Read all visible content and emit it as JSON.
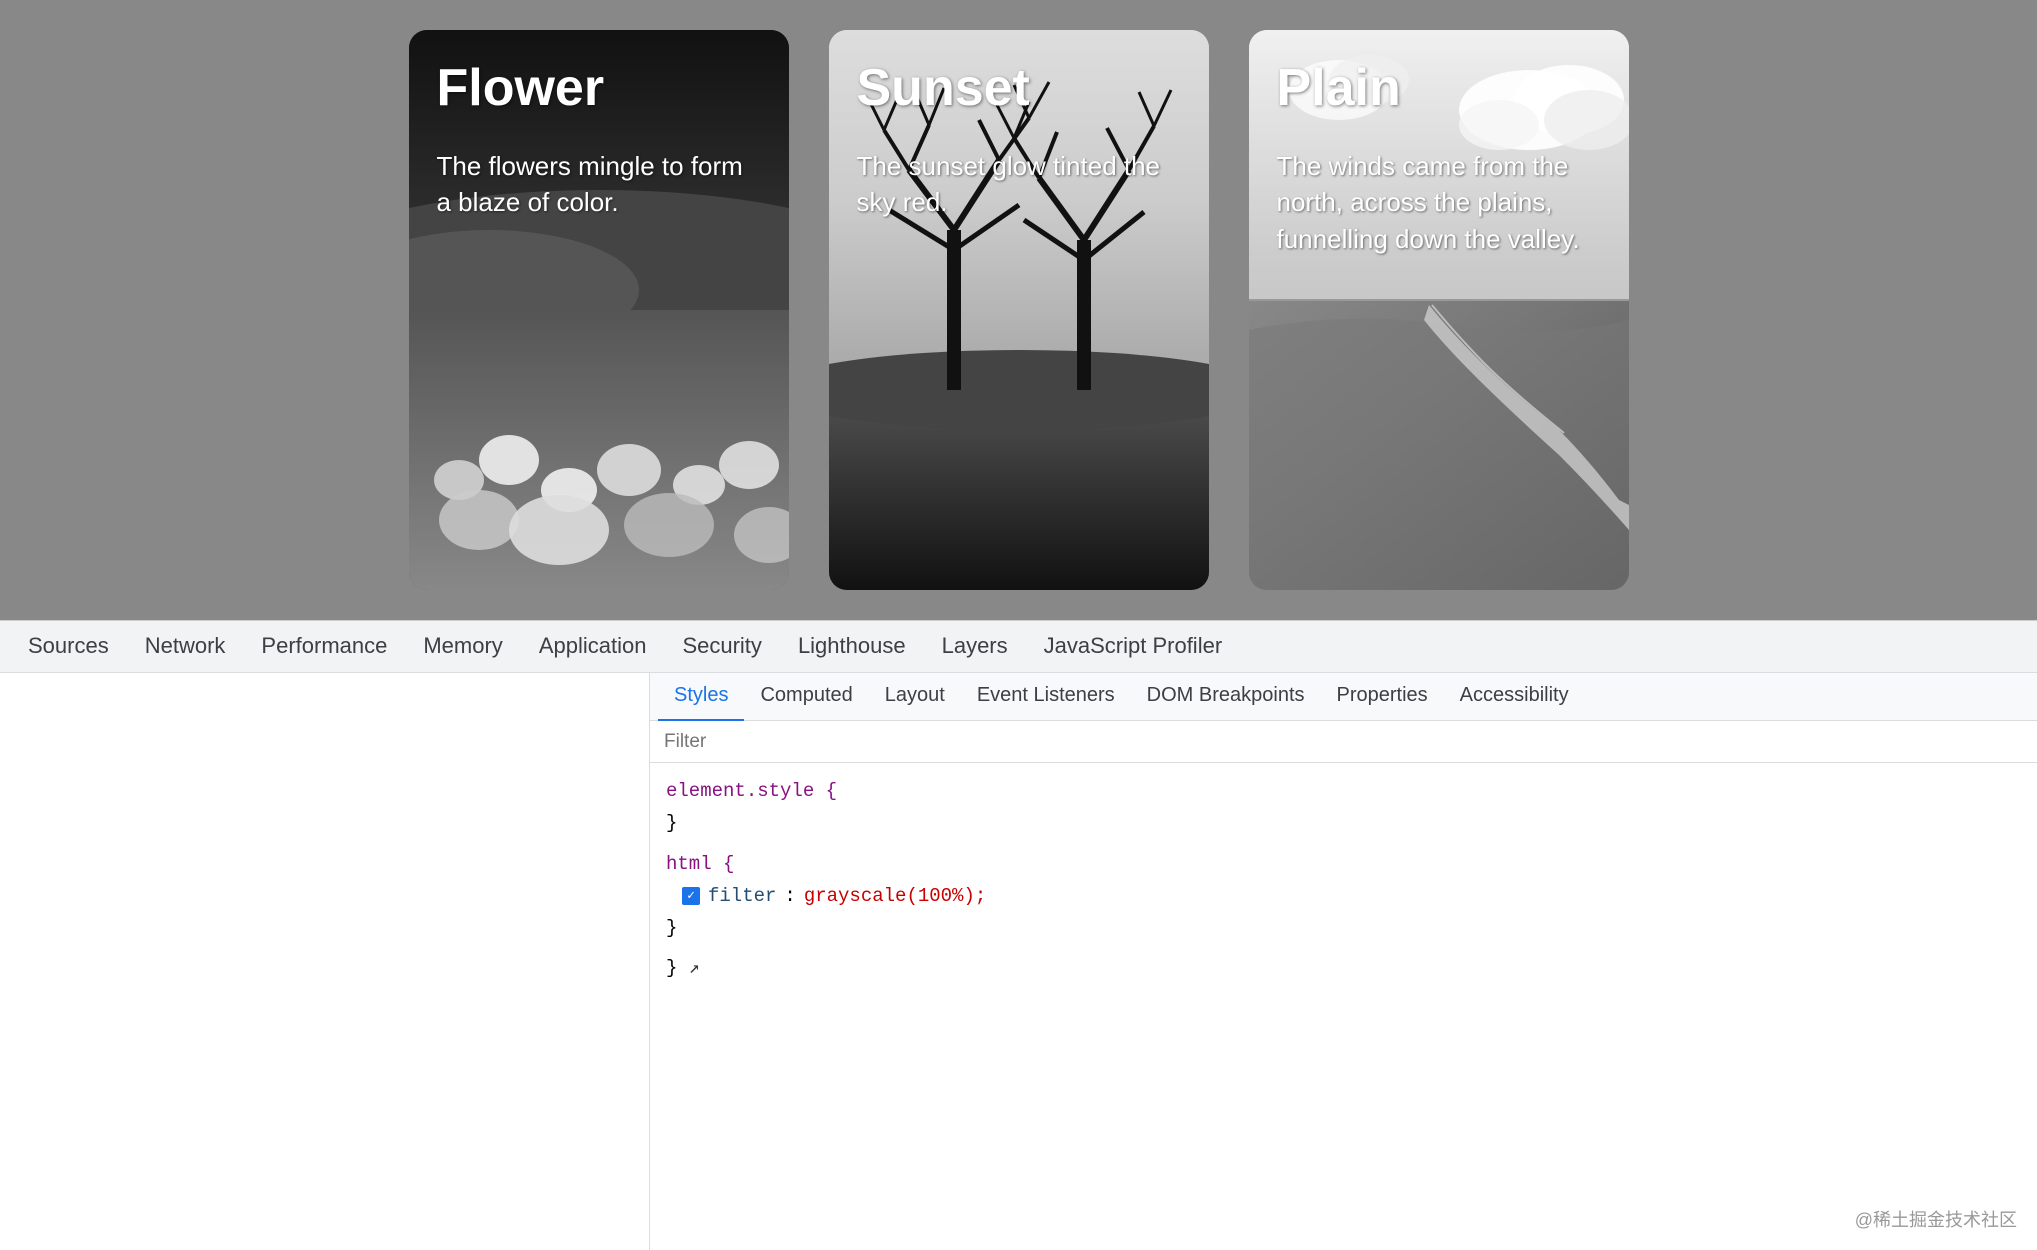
{
  "app": {
    "background": "#888"
  },
  "cards": [
    {
      "id": "flower",
      "title": "Flower",
      "description": "The flowers mingle to form a blaze of color."
    },
    {
      "id": "sunset",
      "title": "Sunset",
      "description": "The sunset glow tinted the sky red."
    },
    {
      "id": "plain",
      "title": "Plain",
      "description": "The winds came from the north, across the plains, funnelling down the valley."
    }
  ],
  "devtools": {
    "top_tabs": [
      {
        "label": "Sources",
        "active": false
      },
      {
        "label": "Network",
        "active": false
      },
      {
        "label": "Performance",
        "active": false
      },
      {
        "label": "Memory",
        "active": false
      },
      {
        "label": "Application",
        "active": false
      },
      {
        "label": "Security",
        "active": false
      },
      {
        "label": "Lighthouse",
        "active": false
      },
      {
        "label": "Layers",
        "active": false
      },
      {
        "label": "JavaScript Profiler",
        "active": false
      }
    ],
    "sub_tabs": [
      {
        "label": "Styles",
        "active": true
      },
      {
        "label": "Computed",
        "active": false
      },
      {
        "label": "Layout",
        "active": false
      },
      {
        "label": "Event Listeners",
        "active": false
      },
      {
        "label": "DOM Breakpoints",
        "active": false
      },
      {
        "label": "Properties",
        "active": false
      },
      {
        "label": "Accessibility",
        "active": false
      }
    ],
    "filter_placeholder": "Filter",
    "css_rules": [
      {
        "selector": "element.style {",
        "closing": "}",
        "properties": []
      },
      {
        "selector": "html {",
        "closing": "}",
        "properties": [
          {
            "checked": true,
            "name": "filter",
            "value": "grayscale(100%);"
          }
        ]
      }
    ],
    "watermark": "@稀土掘金技术社区"
  }
}
